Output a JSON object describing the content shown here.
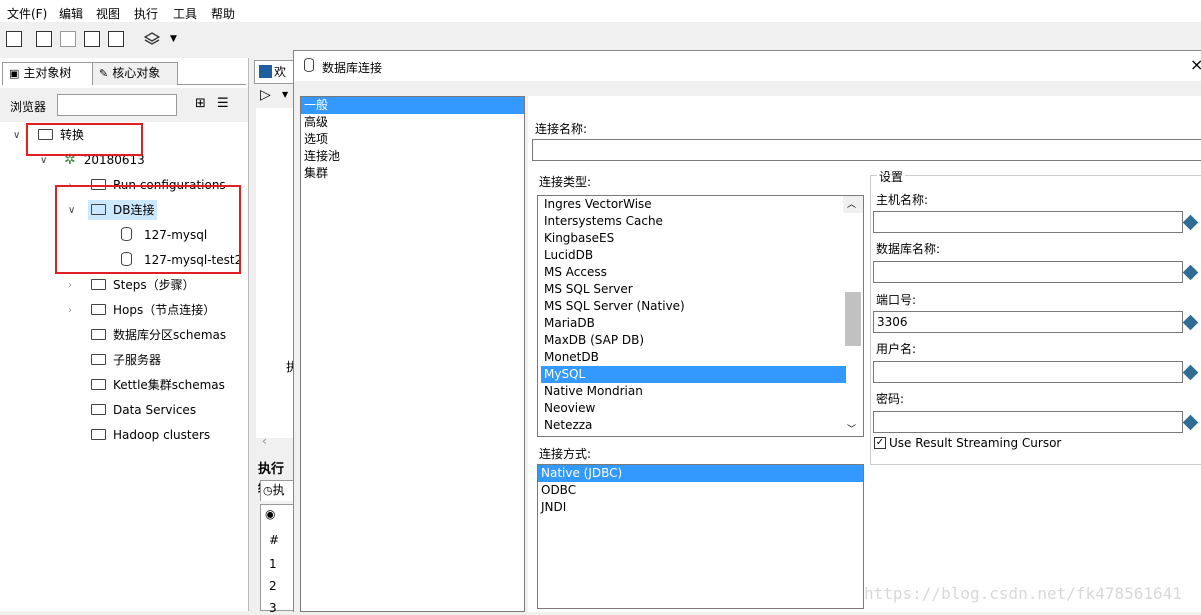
{
  "menu": [
    "文件(F)",
    "编辑",
    "视图",
    "执行",
    "工具",
    "帮助"
  ],
  "left_panel": {
    "tabs": [
      "主对象树",
      "核心对象"
    ],
    "browser_label": "浏览器",
    "tree": {
      "root": "转换",
      "transform": "20180613",
      "run_configs": "Run configurations",
      "db_connections": "DB连接",
      "conn1": "127-mysql",
      "conn2": "127-mysql-test2",
      "steps": "Steps（步骤）",
      "hops": "Hops（节点连接）",
      "partition": "数据库分区schemas",
      "slave": "子服务器",
      "cluster": "Kettle集群schemas",
      "data_services": "Data Services",
      "hadoop": "Hadoop clusters"
    }
  },
  "middle": {
    "tab": "欢",
    "exec_title": "执行结",
    "exec_tab": "执",
    "col_header": "#",
    "rows": [
      "1",
      "2",
      "3"
    ],
    "side_label": "执"
  },
  "dialog": {
    "title": "数据库连接",
    "close": "×",
    "nav": [
      "一般",
      "高级",
      "选项",
      "连接池",
      "集群"
    ],
    "connection_name_label": "连接名称:",
    "connection_name_value": "",
    "connection_type_label": "连接类型:",
    "connection_types": [
      "Ingres VectorWise",
      "Intersystems Cache",
      "KingbaseES",
      "LucidDB",
      "MS Access",
      "MS SQL Server",
      "MS SQL Server (Native)",
      "MariaDB",
      "MaxDB (SAP DB)",
      "MonetDB",
      "MySQL",
      "Native Mondrian",
      "Neoview",
      "Netezza"
    ],
    "selected_type": "MySQL",
    "access_label": "连接方式:",
    "access_methods": [
      "Native (JDBC)",
      "ODBC",
      "JNDI"
    ],
    "selected_access": "Native (JDBC)",
    "settings_label": "设置",
    "host_label": "主机名称:",
    "host_value": "",
    "dbname_label": "数据库名称:",
    "dbname_value": "",
    "port_label": "端口号:",
    "port_value": "3306",
    "user_label": "用户名:",
    "user_value": "",
    "password_label": "密码:",
    "password_value": "",
    "streaming_label": "Use Result Streaming Cursor",
    "streaming_checked": true
  },
  "watermark": "https://blog.csdn.net/fk478561641",
  "colors": {
    "selection": "#3399ff",
    "highlight_box": "#e02020",
    "tree_selected": "#cce8ff"
  }
}
